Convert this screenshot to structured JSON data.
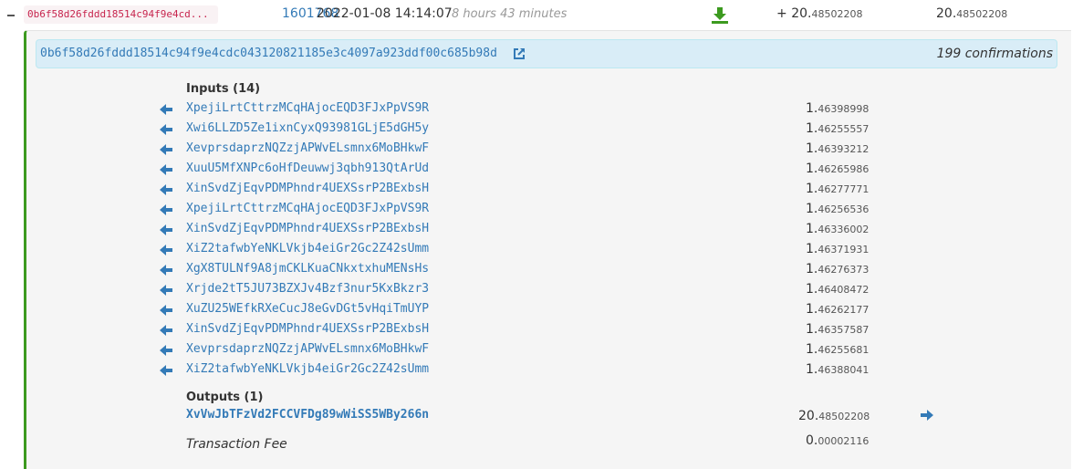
{
  "tx_row": {
    "txid_short": "0b6f58d26fddd18514c94f9e4cd...",
    "block": "1601768",
    "time": "2022-01-08 14:14:07",
    "age": "8 hours 43 minutes",
    "amount_sign": "+ ",
    "amount_int": "20.",
    "amount_dec": "48502208",
    "balance_int": "20.",
    "balance_dec": "48502208",
    "download_icon": "download-icon",
    "download_color": "#3c9a1f"
  },
  "details": {
    "hash": "0b6f58d26fddd18514c94f9e4cdc043120821185e3c4097a923ddf00c685b98d",
    "confirmations": "199 confirmations",
    "inputs_title": "Inputs (14)",
    "inputs": [
      {
        "address": "XpejiLrtCttrzMCqHAjocEQD3FJxPpVS9R",
        "int": "1.",
        "dec": "46398998"
      },
      {
        "address": "Xwi6LLZD5Ze1ixnCyxQ93981GLjE5dGH5y",
        "int": "1.",
        "dec": "46255557"
      },
      {
        "address": "XevprsdaprzNQZzjAPWvELsmnx6MoBHkwF",
        "int": "1.",
        "dec": "46393212"
      },
      {
        "address": "XuuU5MfXNPc6oHfDeuwwj3qbh913QtArUd",
        "int": "1.",
        "dec": "46265986"
      },
      {
        "address": "XinSvdZjEqvPDMPhndr4UEXSsrP2BExbsH",
        "int": "1.",
        "dec": "46277771"
      },
      {
        "address": "XpejiLrtCttrzMCqHAjocEQD3FJxPpVS9R",
        "int": "1.",
        "dec": "46256536"
      },
      {
        "address": "XinSvdZjEqvPDMPhndr4UEXSsrP2BExbsH",
        "int": "1.",
        "dec": "46336002"
      },
      {
        "address": "XiZ2tafwbYeNKLVkjb4eiGr2Gc2Z42sUmm",
        "int": "1.",
        "dec": "46371931"
      },
      {
        "address": "XgX8TULNf9A8jmCKLKuaCNkxtxhuMENsHs",
        "int": "1.",
        "dec": "46276373"
      },
      {
        "address": "Xrjde2tT5JU73BZXJv4Bzf3nur5KxBkzr3",
        "int": "1.",
        "dec": "46408472"
      },
      {
        "address": "XuZU25WEfkRXeCucJ8eGvDGt5vHqiTmUYP",
        "int": "1.",
        "dec": "46262177"
      },
      {
        "address": "XinSvdZjEqvPDMPhndr4UEXSsrP2BExbsH",
        "int": "1.",
        "dec": "46357587"
      },
      {
        "address": "XevprsdaprzNQZzjAPWvELsmnx6MoBHkwF",
        "int": "1.",
        "dec": "46255681"
      },
      {
        "address": "XiZ2tafwbYeNKLVkjb4eiGr2Gc2Z42sUmm",
        "int": "1.",
        "dec": "46388041"
      }
    ],
    "outputs_title": "Outputs (1)",
    "outputs": [
      {
        "address": "XvVwJbTFzVd2FCCVFDg89wWiSS5WBy266n",
        "int": "20.",
        "dec": "48502208"
      }
    ],
    "fee_label": "Transaction Fee",
    "fee_int": "0.",
    "fee_dec": "00002116"
  },
  "icons": {
    "collapse": "minus-icon",
    "external_link": "external-link-icon",
    "input_arrow": "arrow-left-icon",
    "output_arrow": "arrow-right-icon"
  },
  "colors": {
    "link": "#337ab7",
    "accent_green": "#3c9a1f",
    "txid_text": "#c7254e",
    "info_bg": "#d9edf7"
  }
}
